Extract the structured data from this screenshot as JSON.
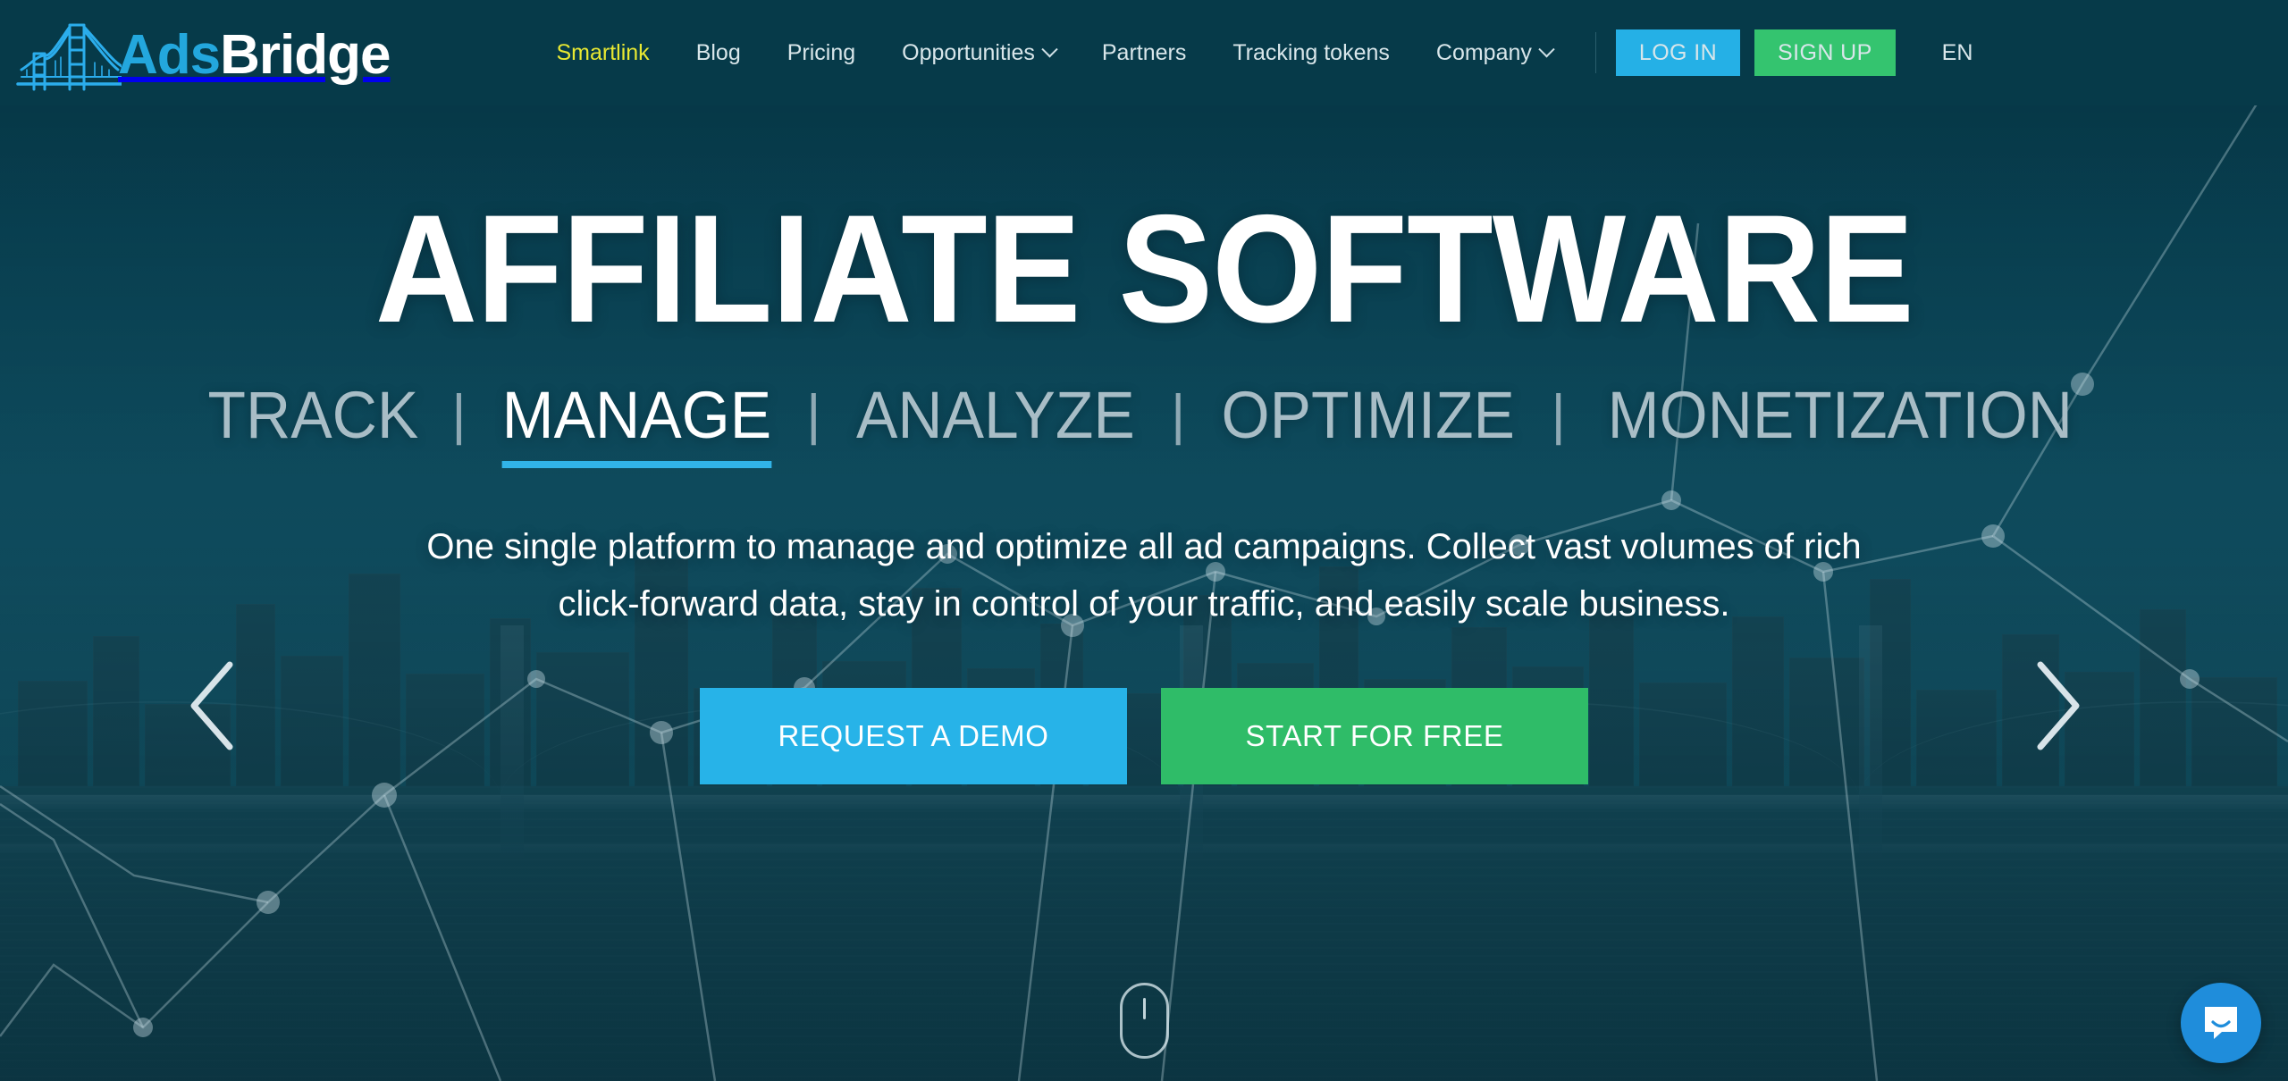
{
  "brand": {
    "logo_icon": "bridge-icon",
    "name_part1": "Ads",
    "name_part2": "Bridge",
    "accent_cyan": "#23a7dd",
    "header_bg": "#063a49"
  },
  "nav": {
    "items": [
      {
        "label": "Smartlink",
        "active": true,
        "has_dropdown": false
      },
      {
        "label": "Blog",
        "active": false,
        "has_dropdown": false
      },
      {
        "label": "Pricing",
        "active": false,
        "has_dropdown": false
      },
      {
        "label": "Opportunities",
        "active": false,
        "has_dropdown": true
      },
      {
        "label": "Partners",
        "active": false,
        "has_dropdown": false
      },
      {
        "label": "Tracking tokens",
        "active": false,
        "has_dropdown": false
      },
      {
        "label": "Company",
        "active": false,
        "has_dropdown": true
      }
    ],
    "login_label": "LOG IN",
    "signup_label": "SIGN UP",
    "language": "EN",
    "login_color": "#25b0e6",
    "signup_color": "#34c46f",
    "active_color": "#e8e832"
  },
  "hero": {
    "title": "AFFILIATE SOFTWARE",
    "steps": [
      {
        "label": "TRACK",
        "active": false
      },
      {
        "label": "MANAGE",
        "active": true
      },
      {
        "label": "ANALYZE",
        "active": false
      },
      {
        "label": "OPTIMIZE",
        "active": false
      },
      {
        "label": "MONETIZATION",
        "active": false
      }
    ],
    "step_separator": "|",
    "active_underline_color": "#31b4e8",
    "lead": "One single platform to manage and optimize all ad campaigns. Collect vast volumes of rich click-forward data, stay in control of your traffic, and easily scale business.",
    "cta_primary": "REQUEST A DEMO",
    "cta_secondary": "START FOR FREE",
    "cta_primary_color": "#27b3e8",
    "cta_secondary_color": "#2fbc68",
    "prev_arrow_icon": "chevron-left-icon",
    "next_arrow_icon": "chevron-right-icon",
    "scroll_hint_icon": "mouse-scroll-icon"
  },
  "widgets": {
    "chat_icon": "chat-bubble-icon",
    "chat_color": "#1f8ddb"
  }
}
